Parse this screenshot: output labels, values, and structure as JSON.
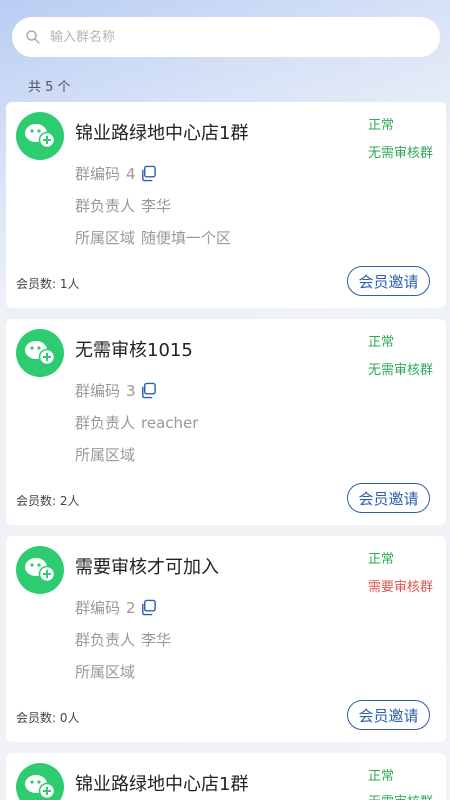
{
  "search": {
    "placeholder": "输入群名称"
  },
  "summary": {
    "count_text": "共 5 个"
  },
  "labels": {
    "code": "群编码",
    "owner": "群负责人",
    "region": "所属区域",
    "invite": "会员邀请"
  },
  "groups": [
    {
      "name": "锦业路绿地中心店1群",
      "code": "4",
      "owner": "李华",
      "region": "随便填一个区",
      "status": "正常",
      "review": "无需审核群",
      "review_color": "#2eaa55",
      "members": "会员数: 1人"
    },
    {
      "name": "无需审核1015",
      "code": "3",
      "owner": "reacher",
      "region": "",
      "status": "正常",
      "review": "无需审核群",
      "review_color": "#2eaa55",
      "members": "会员数: 2人"
    },
    {
      "name": "需要审核才可加入",
      "code": "2",
      "owner": "李华",
      "region": "",
      "status": "正常",
      "review": "需要审核群",
      "review_color": "#e15454",
      "members": "会员数: 0人"
    },
    {
      "name": "锦业路绿地中心店1群",
      "status": "正常",
      "review": "无需审核群",
      "review_color": "#2eaa55"
    }
  ],
  "icons": {
    "search": "search-icon",
    "avatar": "wechat-group-icon",
    "copy": "copy-icon"
  },
  "colors": {
    "accent": "#2d5fab",
    "avatar": "#2ecc71",
    "ok": "#2eaa55",
    "warn": "#e15454"
  }
}
